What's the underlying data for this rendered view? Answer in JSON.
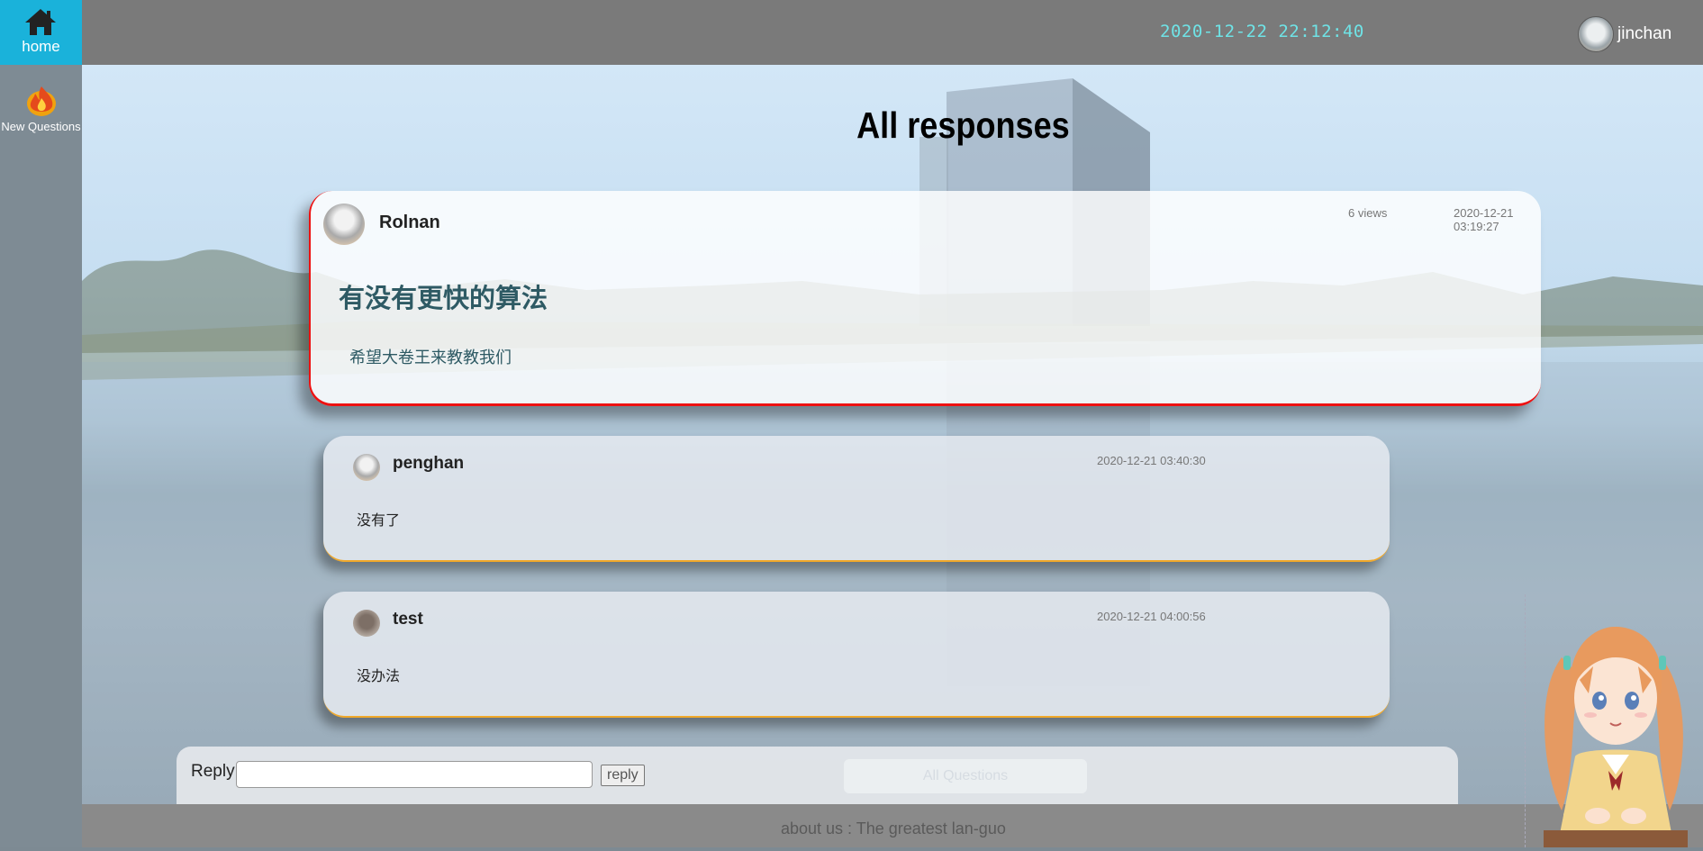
{
  "topbar": {
    "home_label": "home",
    "clock": "2020-12-22 22:12:40",
    "username": "jinchan"
  },
  "sidebar": {
    "items": [
      {
        "label": "New Questions",
        "icon": "fire-icon"
      }
    ]
  },
  "main": {
    "title": "All responses",
    "question": {
      "author": "Rolnan",
      "views": "6 views",
      "time": "2020-12-21 03:19:27",
      "title": "有没有更快的算法",
      "body": "希望大卷王来教教我们"
    },
    "responses": [
      {
        "author": "penghan",
        "time": "2020-12-21 03:40:30",
        "body": "没有了"
      },
      {
        "author": "test",
        "time": "2020-12-21 04:00:56",
        "body": "没办法"
      }
    ],
    "reply": {
      "label": "Reply",
      "input_value": "",
      "button_label": "reply",
      "all_questions_label": "All Questions"
    }
  },
  "footer": {
    "text": "about us : The greatest lan-guo"
  },
  "colors": {
    "accent": "#1ab2da",
    "clock": "#6fe3e6",
    "question_border": "#e11111",
    "response_border": "#f0a82a",
    "question_text": "#2e5a64"
  }
}
